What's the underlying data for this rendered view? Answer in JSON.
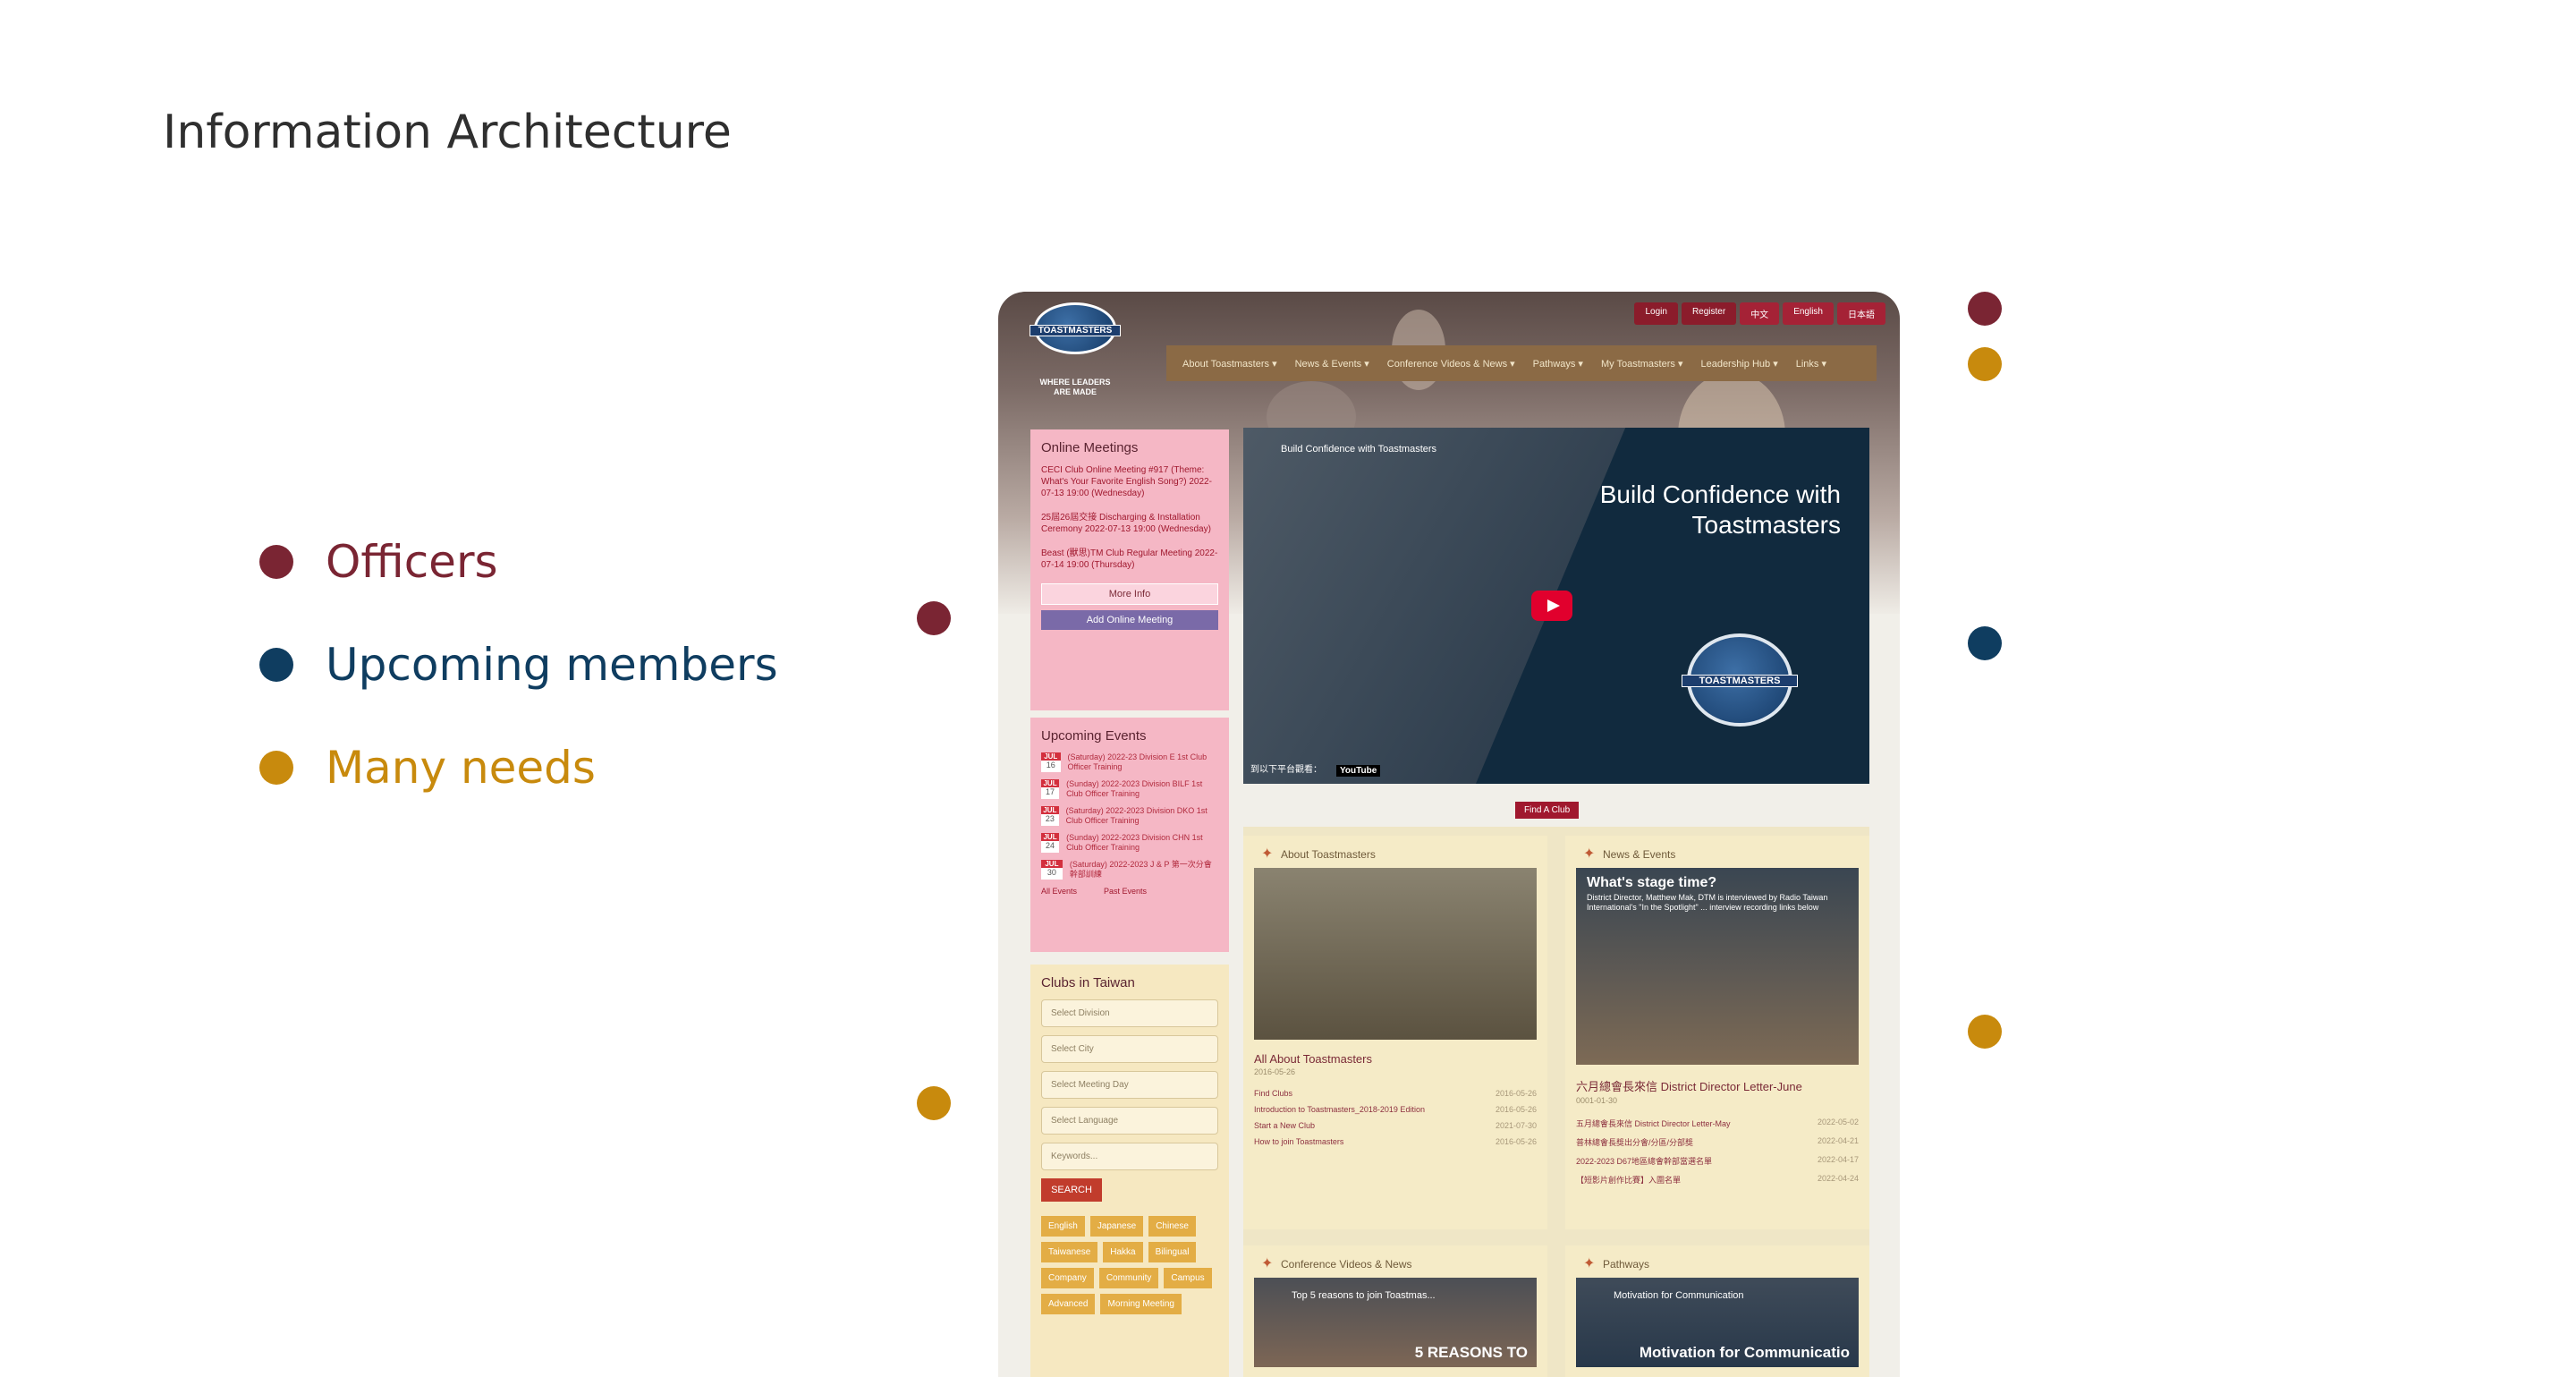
{
  "slide": {
    "title": "Information Architecture",
    "legend": [
      {
        "label": "Officers",
        "color": "#7a2533"
      },
      {
        "label": "Upcoming members",
        "color": "#0f3d60"
      },
      {
        "label": "Many needs",
        "color": "#c88a0d"
      }
    ]
  },
  "site": {
    "logo_ribbon": "TOASTMASTERS",
    "logo_tag_1": "WHERE LEADERS",
    "logo_tag_2": "ARE MADE",
    "top": {
      "login": "Login",
      "register": "Register",
      "lang_zh": "中文",
      "lang_en": "English",
      "lang_ja": "日本語"
    },
    "nav": [
      "About Toastmasters ▾",
      "News & Events ▾",
      "Conference Videos & News ▾",
      "Pathways ▾",
      "My Toastmasters ▾",
      "Leadership Hub ▾",
      "Links ▾"
    ],
    "online": {
      "title": "Online Meetings",
      "meetings": [
        "CECI Club Online Meeting #917 (Theme: What's Your Favorite English Song?) 2022-07-13 19:00 (Wednesday)",
        "25屆26屆交接 Discharging & Installation Ceremony 2022-07-13 19:00 (Wednesday)",
        "Beast (獸思)TM Club Regular Meeting 2022-07-14 19:00 (Thursday)"
      ],
      "more": "More Info",
      "add": "Add Online Meeting"
    },
    "events": {
      "title": "Upcoming Events",
      "items": [
        {
          "m": "JUL",
          "d": "16",
          "t": "(Saturday) 2022-23 Division E 1st Club Officer Training"
        },
        {
          "m": "JUL",
          "d": "17",
          "t": "(Sunday) 2022-2023 Division BILF 1st Club Officer Training"
        },
        {
          "m": "JUL",
          "d": "23",
          "t": "(Saturday) 2022-2023 Division DKO 1st Club Officer Training"
        },
        {
          "m": "JUL",
          "d": "24",
          "t": "(Sunday) 2022-2023 Division CHN 1st Club Officer Training"
        },
        {
          "m": "JUL",
          "d": "30",
          "t": "(Saturday) 2022-2023 J & P 第一次分會幹部訓練"
        }
      ],
      "all": "All Events",
      "past": "Past Events"
    },
    "clubs": {
      "title": "Clubs in Taiwan",
      "selects": [
        "Select Division",
        "Select City",
        "Select Meeting Day",
        "Select Language"
      ],
      "keywords": "Keywords...",
      "search": "SEARCH",
      "tags": [
        "English",
        "Japanese",
        "Chinese",
        "Taiwanese",
        "Hakka",
        "Bilingual",
        "Company",
        "Community",
        "Campus",
        "Advanced",
        "Morning Meeting"
      ]
    },
    "video": {
      "title": "Build Confidence with Toastmasters",
      "headline_1": "Build Confidence with",
      "headline_2": "Toastmasters",
      "logo": "TOASTMASTERS",
      "footer": "到以下平台觀看：",
      "yt": "YouTube"
    },
    "find_club": "Find A Club",
    "about": {
      "title": "About Toastmasters",
      "sub": "All About Toastmasters",
      "date": "2016-05-26",
      "rows": [
        {
          "t": "Find Clubs",
          "d": "2016-05-26"
        },
        {
          "t": "Introduction to Toastmasters_2018-2019 Edition",
          "d": "2016-05-26"
        },
        {
          "t": "Start a New Club",
          "d": "2021-07-30"
        },
        {
          "t": "How to join Toastmasters",
          "d": "2016-05-26"
        }
      ]
    },
    "news": {
      "title": "News & Events",
      "headline": "What's stage time?",
      "headline_sub": "District Director, Matthew Mak, DTM is interviewed by Radio Taiwan International's \"In the Spotlight\" ... interview recording links below",
      "sub": "六月總會長來信 District Director Letter-June",
      "date": "0001-01-30",
      "rows": [
        {
          "t": "五月總會長來信 District Director Letter-May",
          "d": "2022-05-02"
        },
        {
          "t": "普林總會長獎出分會/分區/分部獎",
          "d": "2022-04-21"
        },
        {
          "t": "2022-2023 D67地區總會幹部當選名單",
          "d": "2022-04-17"
        },
        {
          "t": "【短影片創作比賽】入圍名單",
          "d": "2022-04-24"
        }
      ]
    },
    "conf": {
      "title": "Conference Videos & News",
      "thumb": "Top 5 reasons to join Toastmas...",
      "big": "5 REASONS TO"
    },
    "pathways": {
      "title": "Pathways",
      "thumb": "Motivation for Communication",
      "big": "Motivation for Communicatio"
    }
  }
}
